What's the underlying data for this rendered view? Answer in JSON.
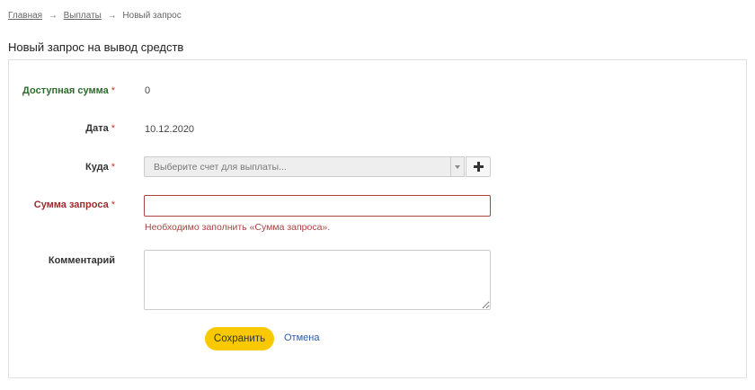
{
  "breadcrumb": {
    "items": [
      "Главная",
      "Выплаты"
    ],
    "current": "Новый запрос",
    "separator": "→"
  },
  "page": {
    "title": "Новый запрос на вывод средств"
  },
  "form": {
    "required_mark": "*",
    "available": {
      "label": "Доступная сумма",
      "value": "0"
    },
    "date": {
      "label": "Дата",
      "value": "10.12.2020"
    },
    "destination": {
      "label": "Куда",
      "placeholder": "Выберите счет для выплаты..."
    },
    "amount": {
      "label": "Сумма запроса",
      "value": "",
      "error": "Необходимо заполнить «Сумма запроса»."
    },
    "comment": {
      "label": "Комментарий",
      "value": ""
    },
    "save_label": "Сохранить",
    "cancel_label": "Отмена"
  },
  "colors": {
    "accent": "#f9c900",
    "error": "#a94442",
    "link": "#2a5db0",
    "label_green": "#2e6b2e"
  }
}
